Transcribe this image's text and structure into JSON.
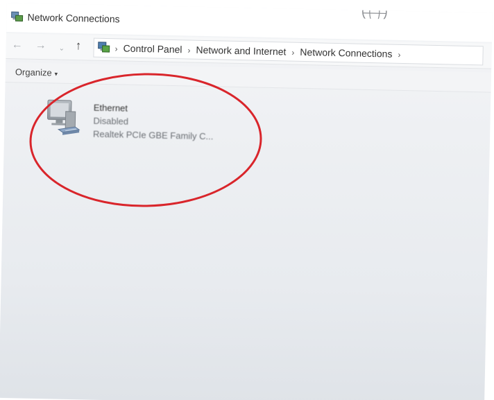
{
  "window": {
    "title": "Network Connections"
  },
  "nav": {
    "back": "←",
    "forward": "→",
    "recent": "⌄",
    "up": "↑"
  },
  "address": {
    "crumbs": [
      "Control Panel",
      "Network and Internet",
      "Network Connections"
    ],
    "separator": "›"
  },
  "toolbar": {
    "organize_label": "Organize",
    "organize_caret": "▾"
  },
  "connections": [
    {
      "name": "Ethernet",
      "status": "Disabled",
      "device": "Realtek PCIe GBE Family C..."
    }
  ],
  "annotation": {
    "shape": "ellipse",
    "color": "#d9252b"
  }
}
